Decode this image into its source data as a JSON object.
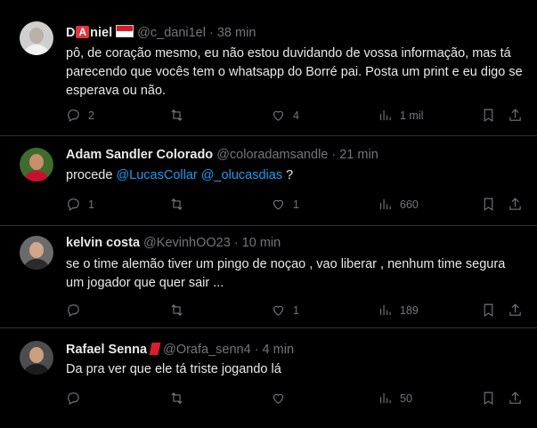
{
  "tweets": [
    {
      "name_prefix": "D",
      "name_box": "A",
      "name_suffix": "niel",
      "handle": "@c_dani1el",
      "time": "· 38 min",
      "text": "pô, de coração mesmo, eu não estou duvidando de vossa informação, mas tá parecendo que vocês tem o whatsapp do Borré pai. Posta um print e eu digo se esperava ou não.",
      "replies": "2",
      "reposts": "",
      "likes": "4",
      "views": "1 mil"
    },
    {
      "name": "Adam Sandler Colorado",
      "handle": "@coloradamsandle",
      "time": "· 21 min",
      "text_before": "procede ",
      "mention1": "@LucasCollar",
      "mention2": "@_olucasdias",
      "text_after": " ?",
      "replies": "1",
      "reposts": "",
      "likes": "1",
      "views": "660"
    },
    {
      "name": "kelvin costa",
      "handle": "@KevinhOO23",
      "time": "· 10 min",
      "text": "se o time alemão tiver um pingo de noçao , vao liberar , nenhum time segura um jogador que quer sair ...",
      "replies": "",
      "reposts": "",
      "likes": "1",
      "views": "189"
    },
    {
      "name": "Rafael Senna",
      "handle": "@Orafa_senn4",
      "time": "· 4 min",
      "text": "Da pra ver que ele tá triste jogando lá",
      "replies": "",
      "reposts": "",
      "likes": "",
      "views": "50"
    }
  ]
}
